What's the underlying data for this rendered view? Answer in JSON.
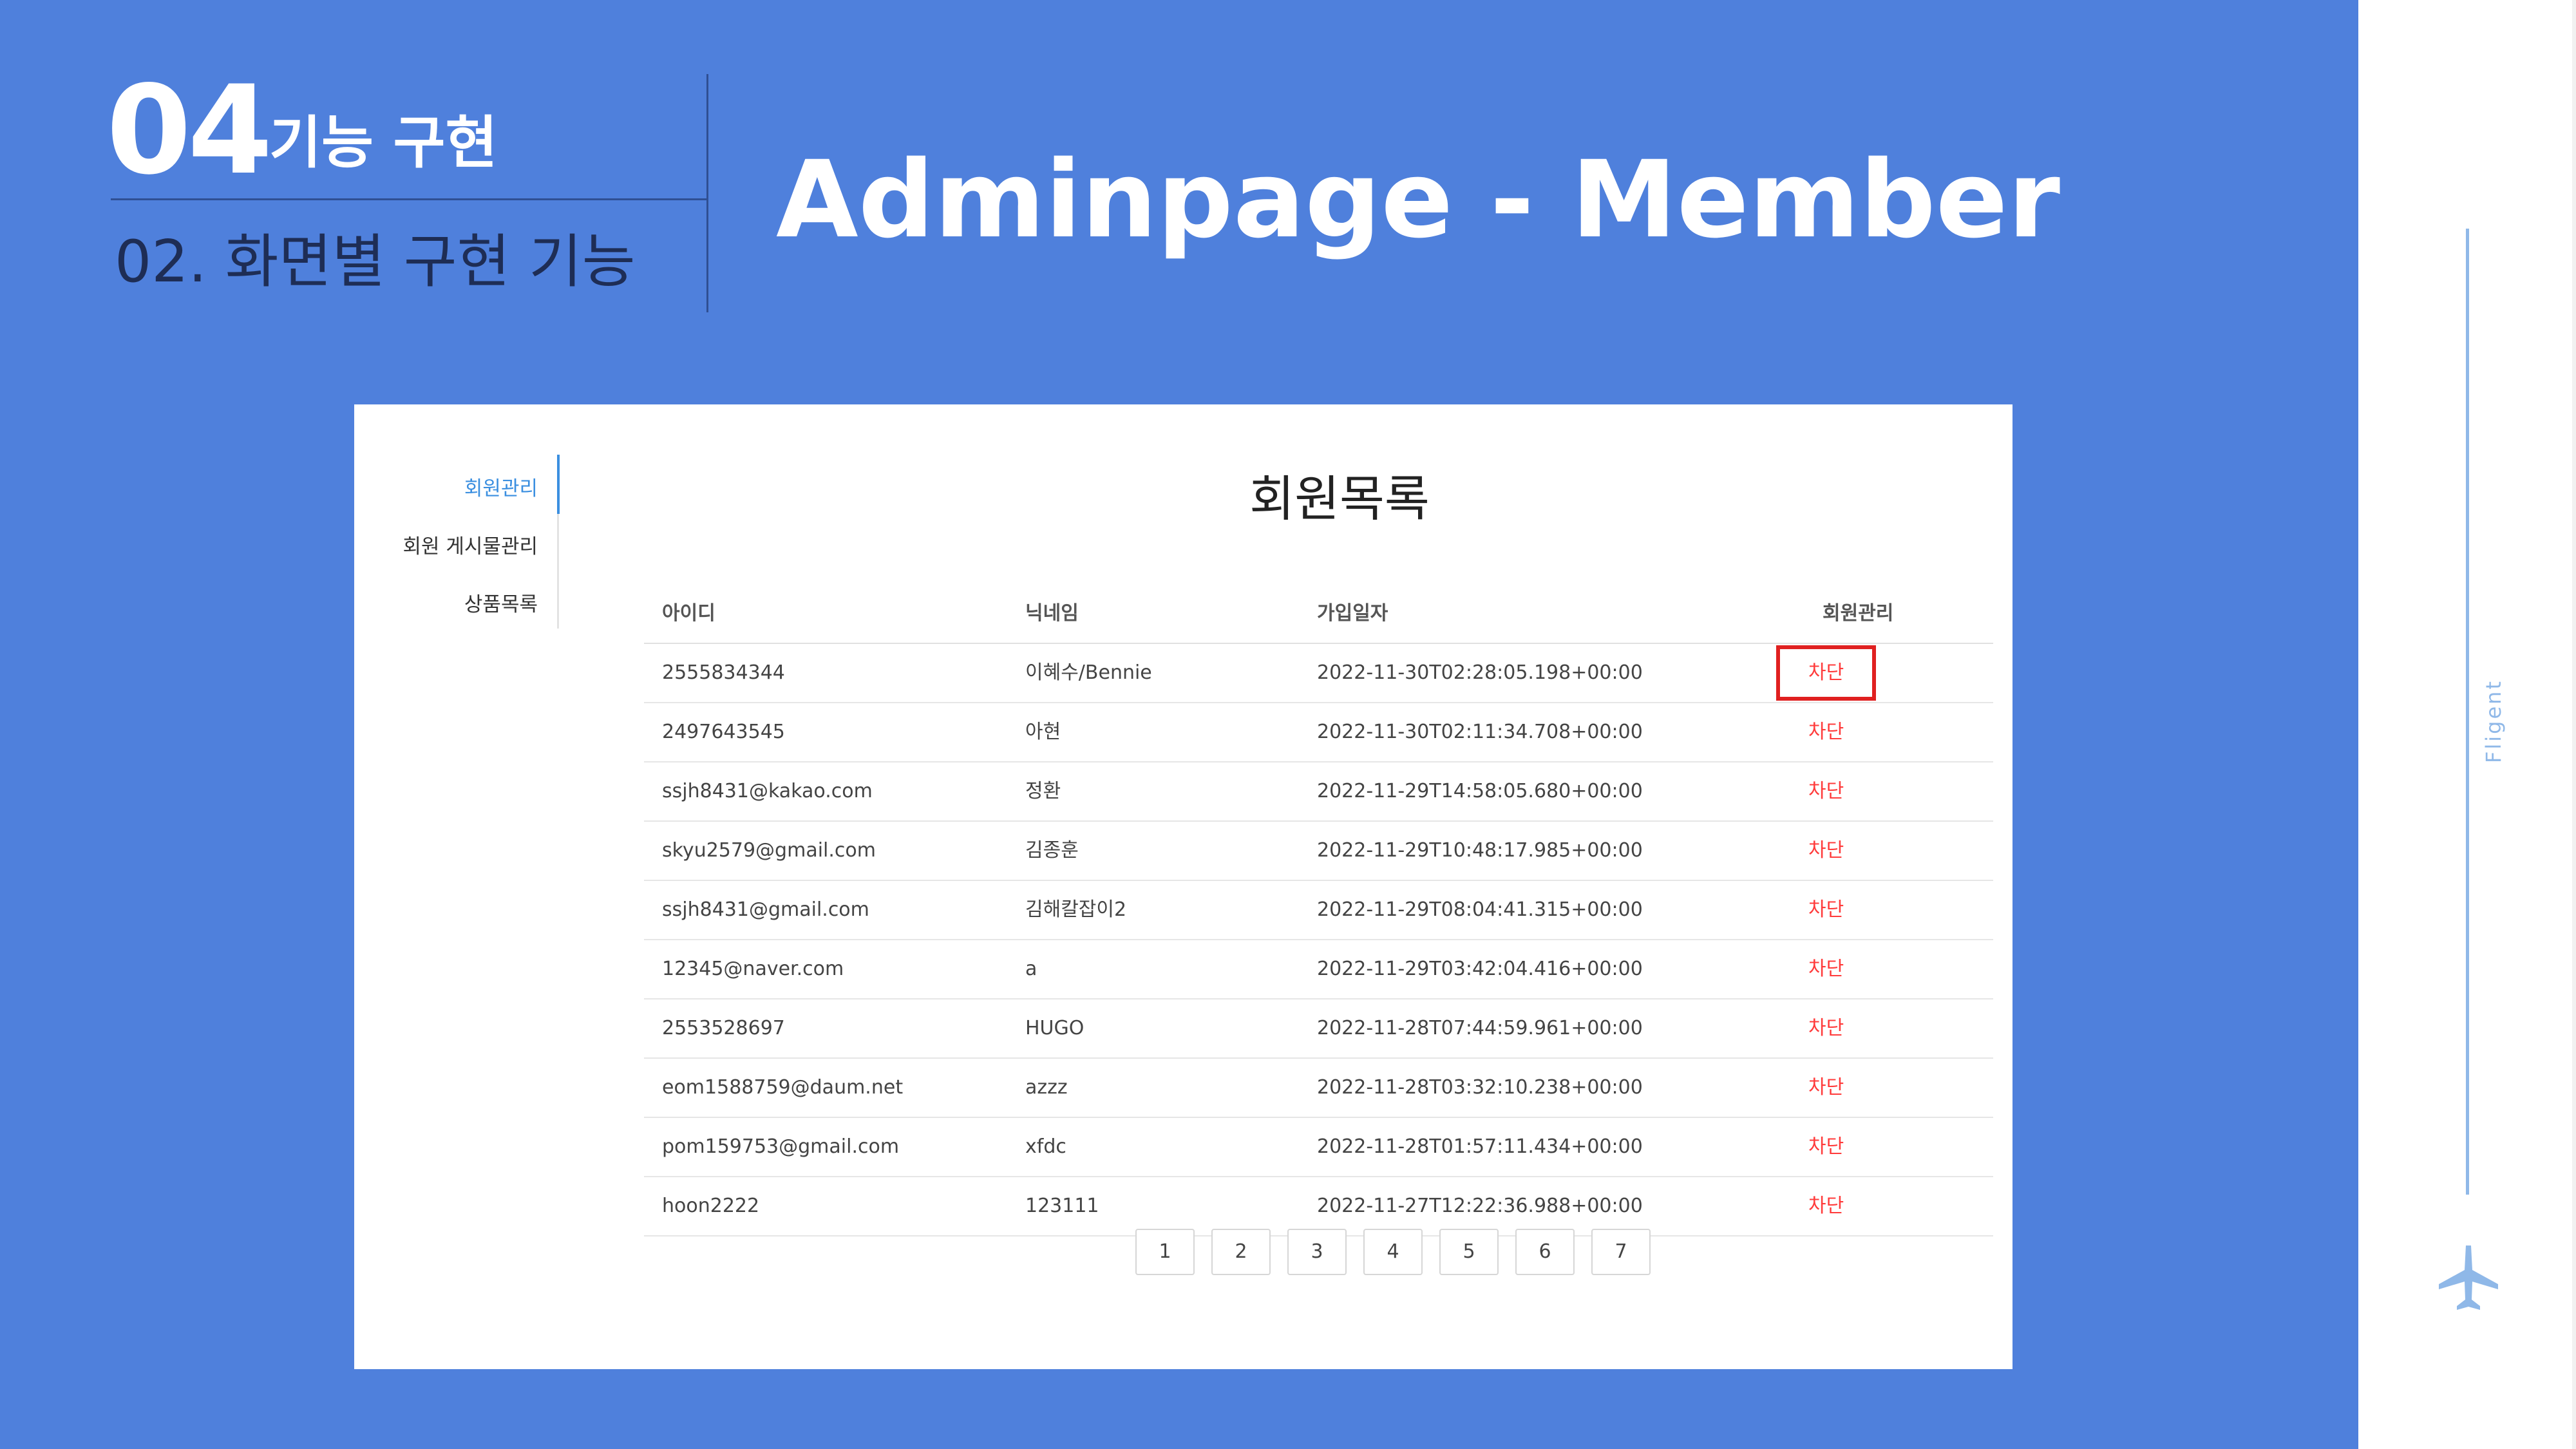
{
  "slide": {
    "section_number": "04",
    "section_title": "기능 구현",
    "subtitle": "02. 화면별 구현 기능",
    "title": "Adminpage - Member",
    "side_brand": "Fligent",
    "accent_color": "#4f80dc"
  },
  "sidebar": {
    "items": [
      {
        "label": "회원관리",
        "active": true
      },
      {
        "label": "회원 게시물관리",
        "active": false
      },
      {
        "label": "상품목록",
        "active": false
      }
    ]
  },
  "main": {
    "title": "회원목록",
    "columns": [
      "아이디",
      "닉네임",
      "가입일자",
      "회원관리"
    ],
    "rows": [
      {
        "id": "2555834344",
        "nickname": "이혜수/Bennie",
        "joined": "2022-11-30T02:28:05.198+00:00",
        "action": "차단"
      },
      {
        "id": "2497643545",
        "nickname": "아현",
        "joined": "2022-11-30T02:11:34.708+00:00",
        "action": "차단"
      },
      {
        "id": "ssjh8431@kakao.com",
        "nickname": "정환",
        "joined": "2022-11-29T14:58:05.680+00:00",
        "action": "차단"
      },
      {
        "id": "skyu2579@gmail.com",
        "nickname": "김종훈",
        "joined": "2022-11-29T10:48:17.985+00:00",
        "action": "차단"
      },
      {
        "id": "ssjh8431@gmail.com",
        "nickname": "김해칼잡이2",
        "joined": "2022-11-29T08:04:41.315+00:00",
        "action": "차단"
      },
      {
        "id": "12345@naver.com",
        "nickname": "a",
        "joined": "2022-11-29T03:42:04.416+00:00",
        "action": "차단"
      },
      {
        "id": "2553528697",
        "nickname": "HUGO",
        "joined": "2022-11-28T07:44:59.961+00:00",
        "action": "차단"
      },
      {
        "id": "eom1588759@daum.net",
        "nickname": "azzz",
        "joined": "2022-11-28T03:32:10.238+00:00",
        "action": "차단"
      },
      {
        "id": "pom159753@gmail.com",
        "nickname": "xfdc",
        "joined": "2022-11-28T01:57:11.434+00:00",
        "action": "차단"
      },
      {
        "id": "hoon2222",
        "nickname": "123111",
        "joined": "2022-11-27T12:22:36.988+00:00",
        "action": "차단"
      }
    ],
    "pagination": [
      "1",
      "2",
      "3",
      "4",
      "5",
      "6",
      "7"
    ],
    "block_color": "#ff3b3b"
  }
}
